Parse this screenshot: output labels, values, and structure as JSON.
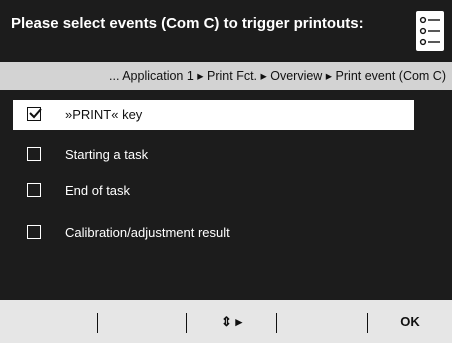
{
  "header": {
    "title": "Please select events (Com C) to trigger printouts:",
    "icon": "list-icon"
  },
  "breadcrumb": "... Application 1 ▸ Print Fct. ▸ Overview ▸ Print event (Com C)",
  "items": [
    {
      "label": "»PRINT« key",
      "checked": true,
      "selected": true
    },
    {
      "label": "Starting a task",
      "checked": false,
      "selected": false
    },
    {
      "label": "End of task",
      "checked": false,
      "selected": false
    },
    {
      "label": "Calibration/adjustment result",
      "checked": false,
      "selected": false
    }
  ],
  "softkeys": {
    "k1": "",
    "k2": "",
    "k3": "⇕ ▸",
    "k4": "",
    "k5": "OK"
  }
}
